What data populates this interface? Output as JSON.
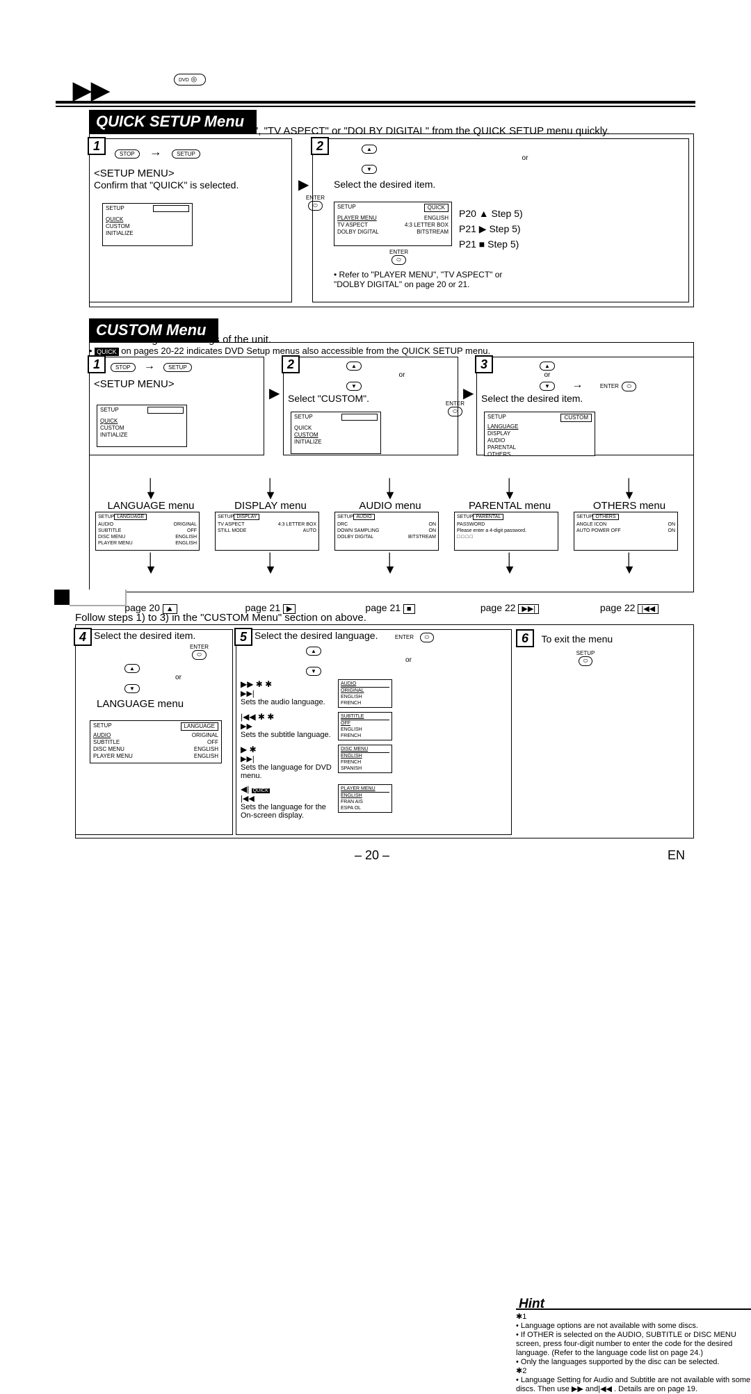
{
  "header": {
    "dvd_label": "DVD"
  },
  "quick_setup": {
    "title": "QUICK SETUP Menu",
    "intro": "You can select the \"PLAYER MENU\", \"TV ASPECT\" or \"DOLBY DIGITAL\" from the QUICK SETUP menu quickly.",
    "step1": {
      "num": "1",
      "btn_stop": "STOP",
      "btn_setup": "SETUP",
      "heading": "<SETUP MENU>",
      "confirm": "Confirm that \"QUICK\" is selected.",
      "btn_enter": "ENTER",
      "screen_hd": "SETUP",
      "screen_items": [
        "QUICK",
        "CUSTOM",
        "INITIALIZE"
      ]
    },
    "step2": {
      "num": "2",
      "or": "or",
      "instruction": "Select the desired item.",
      "screen_hd_l": "SETUP",
      "screen_hd_r": "QUICK",
      "rows": [
        {
          "l": "PLAYER MENU",
          "r": "ENGLISH"
        },
        {
          "l": "TV ASPECT",
          "r": "4:3 LETTER BOX"
        },
        {
          "l": "DOLBY DIGITAL",
          "r": "BITSTREAM"
        }
      ],
      "btn_enter": "ENTER",
      "refs": [
        "P20 ▲ Step 5)",
        "P21 ▶ Step 5)",
        "P21 ■ Step 5)"
      ],
      "note": "• Refer to \"PLAYER MENU\", \"TV ASPECT\" or \"DOLBY DIGITAL\" on page 20 or 21."
    }
  },
  "custom_menu": {
    "title": "CUSTOM Menu",
    "intro1": "You can change the settings of the unit.",
    "intro2_label": "QUICK",
    "intro2": " on pages 20-22 indicates DVD Setup menus also accessible from the QUICK SETUP menu.",
    "step1": {
      "num": "1",
      "btn_stop": "STOP",
      "btn_setup": "SETUP",
      "heading": "<SETUP MENU>",
      "screen_items": [
        "QUICK",
        "CUSTOM",
        "INITIALIZE"
      ],
      "screen_hd": "SETUP"
    },
    "step2": {
      "num": "2",
      "or": "or",
      "instruction": "Select \"CUSTOM\".",
      "btn_enter": "ENTER",
      "screen_items": [
        "QUICK",
        "CUSTOM",
        "INITIALIZE"
      ],
      "screen_hd": "SETUP"
    },
    "step3": {
      "num": "3",
      "or": "or",
      "btn_enter": "ENTER",
      "instruction": "Select the desired item.",
      "screen_hd_l": "SETUP",
      "screen_hd_r": "CUSTOM",
      "screen_items": [
        "LANGUAGE",
        "DISPLAY",
        "AUDIO",
        "PARENTAL",
        "OTHERS"
      ]
    },
    "menus": [
      {
        "title": "LANGUAGE menu",
        "hd_l": "SETUP",
        "hd_r": "LANGUAGE",
        "rows": [
          [
            "AUDIO",
            "ORIGINAL"
          ],
          [
            "SUBTITLE",
            "OFF"
          ],
          [
            "DISC MENU",
            "ENGLISH"
          ],
          [
            "PLAYER MENU",
            "ENGLISH"
          ]
        ],
        "page": "page 20",
        "icon": "▲"
      },
      {
        "title": "DISPLAY menu",
        "hd_l": "SETUP",
        "hd_r": "DISPLAY",
        "rows": [
          [
            "TV ASPECT",
            "4:3 LETTER BOX"
          ],
          [
            "STILL MODE",
            "AUTO"
          ]
        ],
        "page": "page 21",
        "icon": "▶"
      },
      {
        "title": "AUDIO menu",
        "hd_l": "SETUP",
        "hd_r": "AUDIO",
        "rows": [
          [
            "DRC",
            "ON"
          ],
          [
            "DOWN SAMPLING",
            "ON"
          ],
          [
            "DOLBY DIGITAL",
            "BITSTREAM"
          ]
        ],
        "page": "page 21",
        "icon": "■"
      },
      {
        "title": "PARENTAL menu",
        "hd_l": "SETUP",
        "hd_r": "PARENTAL",
        "rows": [
          [
            "PASSWORD",
            ""
          ],
          [
            "Please enter a 4-digit password.",
            ""
          ],
          [
            "□ □ □ □",
            ""
          ]
        ],
        "page": "page 22",
        "icon": "▶▶|"
      },
      {
        "title": "OTHERS menu",
        "hd_l": "SETUP",
        "hd_r": "OTHERS",
        "rows": [
          [
            "ANGLE ICON",
            "ON"
          ],
          [
            "AUTO POWER OFF",
            "ON"
          ]
        ],
        "page": "page 22",
        "icon": "|◀◀"
      }
    ]
  },
  "language_detail": {
    "follow": "Follow steps 1) to 3) in the \"CUSTOM Menu\" section on above.",
    "step4": {
      "num": "4",
      "instruction": "Select the desired item.",
      "btn_enter": "ENTER",
      "or": "or",
      "title": "LANGUAGE menu",
      "hd_l": "SETUP",
      "hd_r": "LANGUAGE",
      "rows": [
        [
          "AUDIO",
          "ORIGINAL"
        ],
        [
          "SUBTITLE",
          "OFF"
        ],
        [
          "DISC MENU",
          "ENGLISH"
        ],
        [
          "PLAYER MENU",
          "ENGLISH"
        ]
      ]
    },
    "step5": {
      "num": "5",
      "instruction": "Select the desired language.",
      "or": "or",
      "btn_enter": "ENTER",
      "sets": [
        {
          "icons": "▶▶   ✱ ✱",
          "sub_icon": "▶▶|",
          "desc": "Sets the audio language.",
          "menu_hd": "AUDIO",
          "opts": [
            "ORIGINAL",
            "ENGLISH",
            "FRENCH"
          ]
        },
        {
          "icons": "|◀◀    ✱ ✱",
          "sub_icon": "▶▶",
          "desc": "Sets the subtitle language.",
          "menu_hd": "SUBTITLE",
          "opts": [
            "OFF",
            "ENGLISH",
            "FRENCH"
          ]
        },
        {
          "icons": "▶        ✱",
          "sub_icon": "▶▶|",
          "desc": "Sets the language for DVD menu.",
          "menu_hd": "DISC MENU",
          "opts": [
            "ENGLISH",
            "FRENCH",
            "SPANISH"
          ]
        },
        {
          "icons": "◀|",
          "sub_icon": "|◀◀",
          "quick": "QUICK",
          "desc": "Sets the language for the On-screen display.",
          "menu_hd": "PLAYER MENU",
          "opts": [
            "ENGLISH",
            "FRAN  AIS",
            "ESPA  OL"
          ]
        }
      ]
    },
    "step6": {
      "num": "6",
      "instruction": "To exit the menu",
      "btn_setup": "SETUP"
    }
  },
  "hint": {
    "title": "Hint",
    "n1": "✱1",
    "l1": "• Language options are not available with some discs.",
    "l2": "• If OTHER is selected on the AUDIO, SUBTITLE or DISC MENU screen, press four-digit number to enter the code for the desired language. (Refer to the language code list on page 24.)",
    "l3": "• Only the languages supported by the disc can be selected.",
    "n2": "✱2",
    "l4": "• Language Setting for Audio and Subtitle are not available with some discs. Then use ▶▶           and|◀◀                      . Details are on page 19."
  },
  "footer": {
    "page": "– 20 –",
    "lang": "EN"
  }
}
